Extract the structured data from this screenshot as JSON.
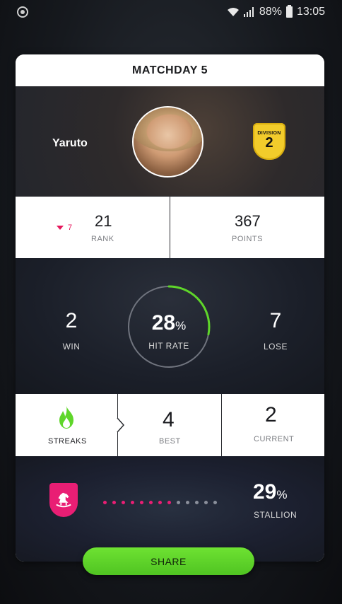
{
  "status_bar": {
    "battery": "88%",
    "time": "13:05"
  },
  "card": {
    "title": "MATCHDAY 5",
    "profile": {
      "name": "Yaruto",
      "division_label": "DIVISION",
      "division_number": "2"
    },
    "rank": {
      "change": "7",
      "value": "21",
      "label": "RANK"
    },
    "points": {
      "value": "367",
      "label": "POINTS"
    },
    "results": {
      "win_value": "2",
      "win_label": "WIN",
      "hit_rate_value": "28",
      "hit_rate_unit": "%",
      "hit_rate_label": "HIT RATE",
      "hit_rate_fraction": 0.28,
      "lose_value": "7",
      "lose_label": "LOSE"
    },
    "streaks": {
      "label": "STREAKS",
      "best_value": "4",
      "best_label": "BEST",
      "current_value": "2",
      "current_label": "CURRENT"
    },
    "stallion": {
      "filled_dots": 8,
      "total_dots": 13,
      "percent_value": "29",
      "percent_unit": "%",
      "label": "STALLION"
    }
  },
  "share_label": "SHARE",
  "colors": {
    "accent_green": "#5fd62a",
    "accent_pink": "#e91e74",
    "division_gold": "#f2cc2b",
    "dot_inactive": "#8a8f9b"
  },
  "icons": {
    "status_left": "app-notification-icon",
    "wifi": "wifi-icon",
    "signal": "signal-icon",
    "battery": "battery-icon",
    "rank_change": "triangle-down-icon",
    "streaks": "flame-icon",
    "stallion": "rocking-horse-icon"
  }
}
